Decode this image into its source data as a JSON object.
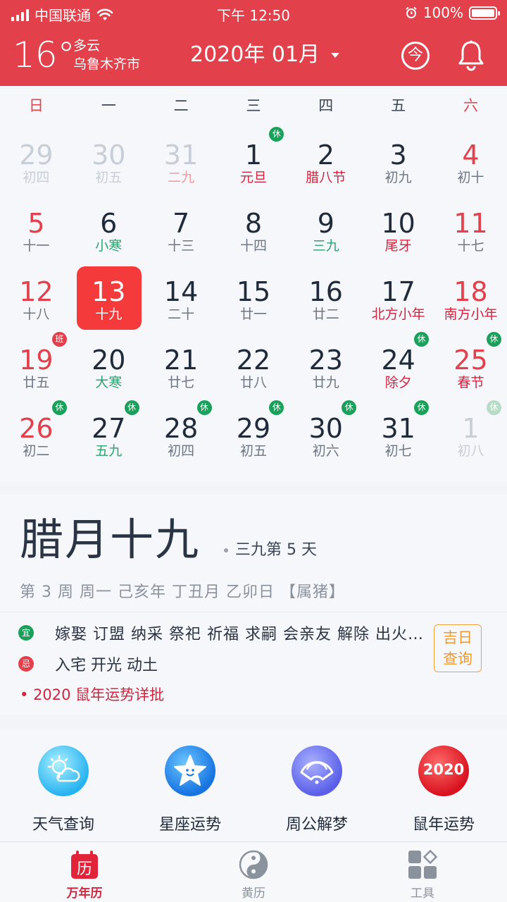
{
  "status_bar": {
    "carrier": "中国联通",
    "time": "下午 12:50",
    "battery": "100%"
  },
  "header": {
    "temperature": "16°",
    "weather_condition": "多云",
    "city": "乌鲁木齐市",
    "month_label": "2020年 01月",
    "today_button": "今",
    "colors": {
      "background": "#e2404a"
    }
  },
  "calendar": {
    "weekdays": [
      "日",
      "一",
      "二",
      "三",
      "四",
      "五",
      "六"
    ],
    "weeks": [
      [
        {
          "day": "29",
          "sub": "初四",
          "faded": true
        },
        {
          "day": "30",
          "sub": "初五",
          "faded": true
        },
        {
          "day": "31",
          "sub": "二九",
          "faded": true,
          "sub_style": "pink"
        },
        {
          "day": "1",
          "sub": "元旦",
          "sub_style": "red",
          "badge": "休"
        },
        {
          "day": "2",
          "sub": "腊八节",
          "sub_style": "red"
        },
        {
          "day": "3",
          "sub": "初九"
        },
        {
          "day": "4",
          "sub": "初十",
          "red": true
        }
      ],
      [
        {
          "day": "5",
          "sub": "十一",
          "red": true
        },
        {
          "day": "6",
          "sub": "小寒",
          "sub_style": "green"
        },
        {
          "day": "7",
          "sub": "十三"
        },
        {
          "day": "8",
          "sub": "十四"
        },
        {
          "day": "9",
          "sub": "三九",
          "sub_style": "green"
        },
        {
          "day": "10",
          "sub": "尾牙",
          "sub_style": "red"
        },
        {
          "day": "11",
          "sub": "十七",
          "red": true
        }
      ],
      [
        {
          "day": "12",
          "sub": "十八",
          "red": true
        },
        {
          "day": "13",
          "sub": "十九",
          "selected": true
        },
        {
          "day": "14",
          "sub": "二十"
        },
        {
          "day": "15",
          "sub": "廿一"
        },
        {
          "day": "16",
          "sub": "廿二"
        },
        {
          "day": "17",
          "sub": "北方小年",
          "sub_style": "red"
        },
        {
          "day": "18",
          "sub": "南方小年",
          "sub_style": "red",
          "red": true
        }
      ],
      [
        {
          "day": "19",
          "sub": "廿五",
          "red": true,
          "badge": "班",
          "badge_style": "red"
        },
        {
          "day": "20",
          "sub": "大寒",
          "sub_style": "green"
        },
        {
          "day": "21",
          "sub": "廿七"
        },
        {
          "day": "22",
          "sub": "廿八"
        },
        {
          "day": "23",
          "sub": "廿九"
        },
        {
          "day": "24",
          "sub": "除夕",
          "sub_style": "red",
          "badge": "休"
        },
        {
          "day": "25",
          "sub": "春节",
          "sub_style": "red",
          "red": true,
          "badge": "休"
        }
      ],
      [
        {
          "day": "26",
          "sub": "初二",
          "red": true,
          "badge": "休"
        },
        {
          "day": "27",
          "sub": "五九",
          "sub_style": "green",
          "badge": "休"
        },
        {
          "day": "28",
          "sub": "初四",
          "badge": "休"
        },
        {
          "day": "29",
          "sub": "初五",
          "badge": "休"
        },
        {
          "day": "30",
          "sub": "初六",
          "badge": "休"
        },
        {
          "day": "31",
          "sub": "初七",
          "badge": "休"
        },
        {
          "day": "1",
          "sub": "初八",
          "faded": true,
          "badge": "休",
          "badge_style": "faded"
        }
      ]
    ]
  },
  "day_info": {
    "lunar_date": "腊月十九",
    "nine_period": "三九第 5 天",
    "ganzhi_line": "第 3 周  周一  己亥年  丁丑月  乙卯日  【属猪】",
    "yi_badge": "宜",
    "yi_text": "嫁娶 订盟 纳采 祭祀 祈福 求嗣 会亲友 解除 出火 安床",
    "ji_badge": "忌",
    "ji_text": "入宅 开光 动土",
    "good_day_button": [
      "吉日",
      "查询"
    ],
    "fortune_link": "2020 鼠年运势详批"
  },
  "tools": [
    {
      "label": "天气查询",
      "icon": "weather-icon"
    },
    {
      "label": "星座运势",
      "icon": "star-icon"
    },
    {
      "label": "周公解梦",
      "icon": "fan-icon"
    },
    {
      "label": "鼠年运势",
      "icon": "rat-year-icon",
      "badge_text": "2020"
    }
  ],
  "tabbar": [
    {
      "label": "万年历",
      "icon_text": "历",
      "active": true
    },
    {
      "label": "黄历"
    },
    {
      "label": "工具"
    }
  ]
}
